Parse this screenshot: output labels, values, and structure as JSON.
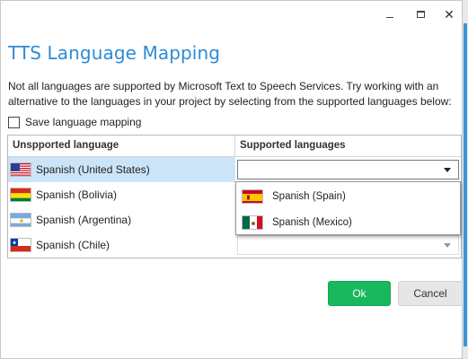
{
  "dialog": {
    "title": "TTS Language Mapping",
    "description": "Not all languages are supported by Microsoft Text to Speech Services. Try working with an alternative to the languages in your project by selecting from the supported languages below:",
    "save_mapping_label": "Save language mapping",
    "save_mapping_checked": false
  },
  "window_controls": {
    "minimize_icon": "minimize-icon",
    "maximize_icon": "maximize-icon",
    "close_glyph": "✕"
  },
  "grid": {
    "headers": [
      "Unspported language",
      "Supported languages"
    ],
    "rows": [
      {
        "language": "Spanish (United States)",
        "flag": "flag-us-icon",
        "selected": true,
        "supported": ""
      },
      {
        "language": "Spanish (Bolivia)",
        "flag": "flag-bolivia-icon",
        "selected": false,
        "supported": ""
      },
      {
        "language": "Spanish (Argentina)",
        "flag": "flag-argentina-icon",
        "selected": false,
        "supported": ""
      },
      {
        "language": "Spanish (Chile)",
        "flag": "flag-chile-icon",
        "selected": false,
        "supported": ""
      }
    ]
  },
  "dropdown": {
    "options": [
      {
        "label": "Spanish (Spain)",
        "flag": "flag-spain-icon"
      },
      {
        "label": "Spanish (Mexico)",
        "flag": "flag-mexico-icon"
      }
    ]
  },
  "buttons": {
    "ok_label": "Ok",
    "cancel_label": "Cancel"
  },
  "colors": {
    "title_blue": "#2e8bd6",
    "ok_green": "#19b85f",
    "selection_blue": "#cce4f7"
  }
}
